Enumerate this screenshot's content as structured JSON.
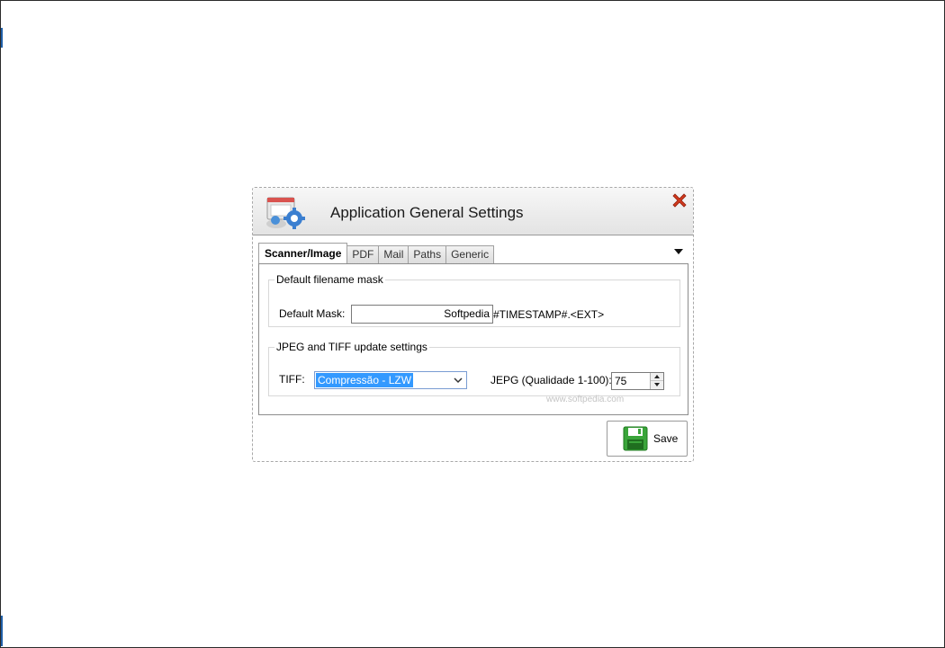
{
  "dialog": {
    "title": "Application General Settings",
    "icons": {
      "header": "settings-gear-icon",
      "close": "close-icon",
      "menu": "dropdown-arrow-icon",
      "save": "floppy-disk-icon"
    },
    "colors": {
      "close_red": "#d23a1e",
      "selection_blue": "#3399ff",
      "save_green": "#3aa53a"
    }
  },
  "tabs": [
    {
      "label": "Scanner/Image",
      "active": true
    },
    {
      "label": "PDF",
      "active": false
    },
    {
      "label": "Mail",
      "active": false
    },
    {
      "label": "Paths",
      "active": false
    },
    {
      "label": "Generic",
      "active": false
    }
  ],
  "filename_group": {
    "legend": "Default filename mask",
    "mask_label": "Default Mask:",
    "mask_value": "Softpedia",
    "mask_suffix": "#TIMESTAMP#.<EXT>"
  },
  "update_group": {
    "legend": "JPEG and TIFF update settings",
    "tiff_label": "TIFF:",
    "tiff_selected": "Compressão - LZW",
    "jpeg_label": "JEPG (Qualidade 1-100):",
    "jpeg_value": "75",
    "watermark": "www.softpedia.com"
  },
  "save_button": {
    "label": "Save"
  }
}
